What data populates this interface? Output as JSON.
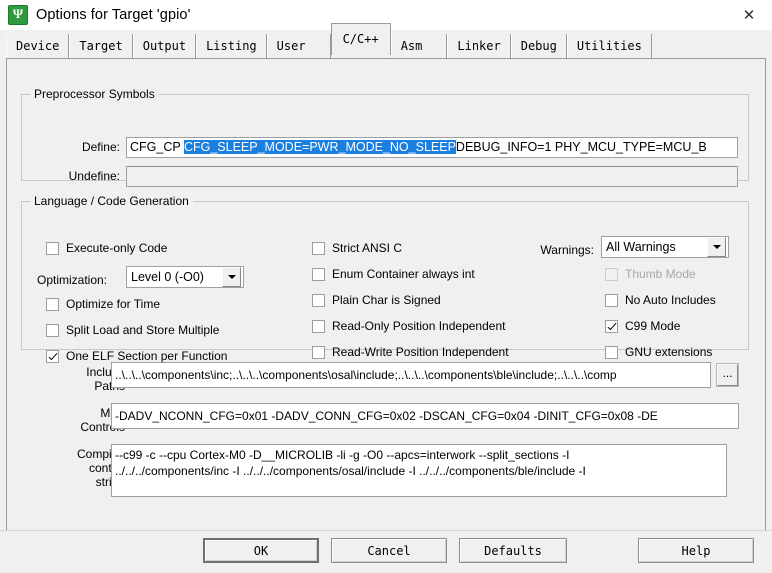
{
  "window": {
    "title": "Options for Target 'gpio'",
    "icon": "uvision-logo-icon",
    "close_label": "✕"
  },
  "tabs": [
    {
      "label": "Device",
      "active": false
    },
    {
      "label": "Target",
      "active": false
    },
    {
      "label": "Output",
      "active": false
    },
    {
      "label": "Listing",
      "active": false
    },
    {
      "label": "User",
      "active": false
    },
    {
      "label": "C/C++",
      "active": true
    },
    {
      "label": "Asm",
      "active": false
    },
    {
      "label": "Linker",
      "active": false
    },
    {
      "label": "Debug",
      "active": false
    },
    {
      "label": "Utilities",
      "active": false
    }
  ],
  "preprocessor": {
    "legend": "Preprocessor Symbols",
    "define_label": "Define:",
    "define_prefix": "CFG_CP ",
    "define_selected": "CFG_SLEEP_MODE=PWR_MODE_NO_SLEEP",
    "define_suffix": "DEBUG_INFO=1 PHY_MCU_TYPE=MCU_B",
    "undefine_label": "Undefine:",
    "undefine_value": ""
  },
  "language": {
    "legend": "Language / Code Generation",
    "col1": [
      {
        "label": "Execute-only Code",
        "checked": false,
        "disabled": false
      },
      {
        "label": "Optimize for Time",
        "checked": false,
        "disabled": false
      },
      {
        "label": "Split Load and Store Multiple",
        "checked": false,
        "disabled": false
      },
      {
        "label": "One ELF Section per Function",
        "checked": true,
        "disabled": false
      }
    ],
    "optimization_label": "Optimization:",
    "optimization_value": "Level 0 (-O0)",
    "col2": [
      {
        "label": "Strict ANSI C",
        "checked": false,
        "disabled": false
      },
      {
        "label": "Enum Container always int",
        "checked": false,
        "disabled": false
      },
      {
        "label": "Plain Char is Signed",
        "checked": false,
        "disabled": false
      },
      {
        "label": "Read-Only Position Independent",
        "checked": false,
        "disabled": false
      },
      {
        "label": "Read-Write Position Independent",
        "checked": false,
        "disabled": false
      }
    ],
    "warnings_label": "Warnings:",
    "warnings_value": "All Warnings",
    "col3": [
      {
        "label": "Thumb Mode",
        "checked": false,
        "disabled": true
      },
      {
        "label": "No Auto Includes",
        "checked": false,
        "disabled": false
      },
      {
        "label": "C99 Mode",
        "checked": true,
        "disabled": false
      },
      {
        "label": "GNU extensions",
        "checked": false,
        "disabled": false
      }
    ]
  },
  "paths": {
    "include_label_line1": "Include",
    "include_label_line2": "Paths",
    "include_value": "..\\..\\..\\components\\inc;..\\..\\..\\components\\osal\\include;..\\..\\..\\components\\ble\\include;..\\..\\..\\comp",
    "browse_label": "...",
    "misc_label_line1": "Misc",
    "misc_label_line2": "Controls",
    "misc_value": "-DADV_NCONN_CFG=0x01  -DADV_CONN_CFG=0x02  -DSCAN_CFG=0x04  -DINIT_CFG=0x08  -DE",
    "compiler_label_line1": "Compiler",
    "compiler_label_line2": "control",
    "compiler_label_line3": "string",
    "compiler_value_line1": "--c99 -c --cpu Cortex-M0 -D__MICROLIB -li -g -O0 --apcs=interwork --split_sections -I",
    "compiler_value_line2": "../../../components/inc -I ../../../components/osal/include -I ../../../components/ble/include -I"
  },
  "buttons": {
    "ok": "OK",
    "cancel": "Cancel",
    "defaults": "Defaults",
    "help": "Help"
  },
  "colors": {
    "selection": "#1b7fe0",
    "dialog_bg": "#f0f0f0",
    "icon_green": "#2e9b3f"
  }
}
